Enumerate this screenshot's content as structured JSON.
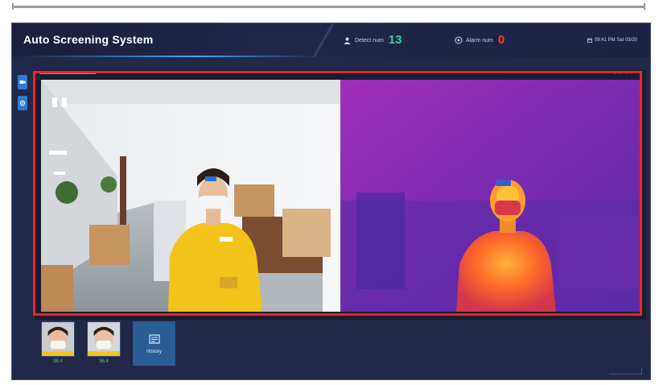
{
  "window": {
    "title": "Auto Screening System"
  },
  "stats": {
    "detect_label": "Detect num",
    "detect_value": "13",
    "alarm_label": "Alarm num",
    "alarm_value": "0"
  },
  "clock": {
    "text": "09:41 PM Sat 03/20"
  },
  "viewer": {
    "rgb_feed": "rgb-camera-feed",
    "thermal_feed": "thermal-camera-feed",
    "highlight_color": "#e8242c"
  },
  "history": {
    "snapshots": [
      {
        "temp": "36.4"
      },
      {
        "temp": "36.4"
      }
    ],
    "button_label": "History"
  },
  "colors": {
    "frame_bg": "#222848",
    "accent_blue": "#3fa8ff",
    "detect_green": "#35d39a",
    "alarm_red": "#ff3b3b"
  }
}
